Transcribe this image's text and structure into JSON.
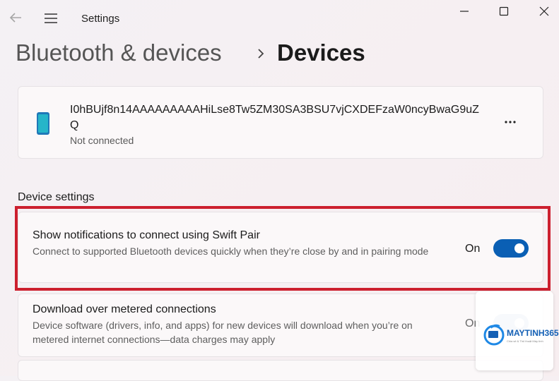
{
  "window": {
    "title": "Settings"
  },
  "breadcrumb": {
    "parent": "Bluetooth & devices",
    "current": "Devices"
  },
  "device": {
    "name": "I0hBUjf8n14AAAAAAAAAHiLse8Tw5ZM30SA3BSU7vjCXDEFzaW0ncyBwaG9uZQ",
    "status": "Not connected",
    "icon": "phone-icon"
  },
  "device_settings": {
    "title": "Device settings",
    "swift_pair": {
      "title": "Show notifications to connect using Swift Pair",
      "description": "Connect to supported Bluetooth devices quickly when they’re close by and in pairing mode",
      "state_label": "On",
      "on": true
    },
    "metered": {
      "title": "Download over metered connections",
      "description": "Device software (drivers, info, and apps) for new devices will download when you’re on metered internet connections—data charges may apply",
      "state_label": "On"
    }
  },
  "watermark": {
    "brand": "MAYTINH365",
    "tagline": "Chia sẻ & Thủ thuật Máy tính"
  },
  "colors": {
    "accent": "#0a5fb4",
    "highlight_border": "#cc1f2e"
  }
}
